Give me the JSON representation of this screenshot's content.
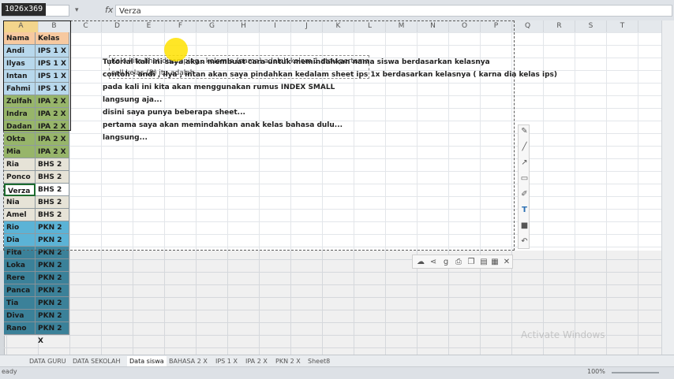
{
  "formula_bar": {
    "name_box": "",
    "formula": "Verza"
  },
  "dimension_badge": "1026x369",
  "columns": [
    "A",
    "B",
    "C",
    "D",
    "E",
    "F",
    "G",
    "H",
    "I",
    "J",
    "K",
    "L",
    "M",
    "N",
    "O",
    "P",
    "Q",
    "R",
    "S",
    "T"
  ],
  "sheet_rows": [
    {
      "nama": "Nama",
      "kelas": "Kelas",
      "shade": "#f7c9a0"
    },
    {
      "nama": "Andi",
      "kelas": "IPS 1 X",
      "shade": "#b8d8ec"
    },
    {
      "nama": "Ilyas",
      "kelas": "IPS 1 X",
      "shade": "#b8d8ec"
    },
    {
      "nama": "Intan",
      "kelas": "IPS 1 X",
      "shade": "#b8d8ec"
    },
    {
      "nama": "Fahmi",
      "kelas": "IPS 1 X",
      "shade": "#b8d8ec"
    },
    {
      "nama": "Zulfah",
      "kelas": "IPA 2 X",
      "shade": "#97b56a"
    },
    {
      "nama": "Indra",
      "kelas": "IPA 2 X",
      "shade": "#97b56a"
    },
    {
      "nama": "Dadan",
      "kelas": "IPA 2 X",
      "shade": "#97b56a"
    },
    {
      "nama": "Okta",
      "kelas": "IPA 2 X",
      "shade": "#97b56a"
    },
    {
      "nama": "Mia",
      "kelas": "IPA 2 X",
      "shade": "#97b56a"
    },
    {
      "nama": "Ria",
      "kelas": "BHS 2 X",
      "shade": "#e6e3d7"
    },
    {
      "nama": "Ponco",
      "kelas": "BHS 2 X",
      "shade": "#e6e3d7"
    },
    {
      "nama": "Verza",
      "kelas": "BHS 2 X",
      "shade": "#ffffff"
    },
    {
      "nama": "Nia",
      "kelas": "BHS 2 X",
      "shade": "#e6e3d7"
    },
    {
      "nama": "Amel",
      "kelas": "BHS 2 X",
      "shade": "#e6e3d7"
    },
    {
      "nama": "Rio",
      "kelas": "PKN 2 X",
      "shade": "#5bb3d6"
    },
    {
      "nama": "Dia",
      "kelas": "PKN 2 X",
      "shade": "#5bb3d6"
    },
    {
      "nama": "Fita",
      "kelas": "PKN 2 X",
      "shade": "#3f8aa3"
    },
    {
      "nama": "Loka",
      "kelas": "PKN 2 X",
      "shade": "#3f8aa3"
    },
    {
      "nama": "Rere",
      "kelas": "PKN 2 X",
      "shade": "#3f8aa3"
    },
    {
      "nama": "Panca",
      "kelas": "PKN 2 X",
      "shade": "#3f8aa3"
    },
    {
      "nama": "Tia",
      "kelas": "PKN 2 X",
      "shade": "#3f8aa3"
    },
    {
      "nama": "Diva",
      "kelas": "PKN 2 X",
      "shade": "#3f8aa3"
    },
    {
      "nama": "Rano",
      "kelas": "PKN 2 X",
      "shade": "#3f8aa3"
    }
  ],
  "note_box": {
    "line1": "Kalo kita lihat disamping . kolom a (nama) adalah kolom 1 atau pertama . lalu",
    "line2": "cell kelas (B) itu adalah"
  },
  "tutorial_lines": [
    "Tutorial kali ini saya akan membuat cara untuk memindahkan nama siswa berdasarkan kelasnya",
    "contoh : andi , ilya , intan akan saya pindahkan kedalam sheet ips 1x berdasarkan kelasnya ( karna dia kelas ips)",
    "pada kali ini kita akan menggunakan rumus INDEX SMALL",
    "langsung aja...",
    "disini saya punya beberapa sheet...",
    "pertama saya akan memindahkan anak kelas bahasa dulu...",
    "langsung..."
  ],
  "sheet_tabs": [
    "DATA GURU",
    "DATA SEKOLAH",
    "Data siswa",
    "BAHASA 2 X",
    "IPS 1 X",
    "IPA 2 X",
    "PKN 2 X",
    "Sheet8"
  ],
  "status": {
    "left": "eady",
    "zoom": "100%"
  },
  "watermark": "Activate Windows",
  "draw_tools": [
    "pencil-icon",
    "line-icon",
    "arrow-icon",
    "rectangle-icon",
    "marker-icon",
    "text-icon",
    "color-icon",
    "undo-icon"
  ],
  "share_tools": [
    "upload-cloud-icon",
    "share-icon",
    "google-icon",
    "print-icon",
    "copy-icon",
    "save-icon",
    "save-as-icon",
    "close-icon"
  ]
}
